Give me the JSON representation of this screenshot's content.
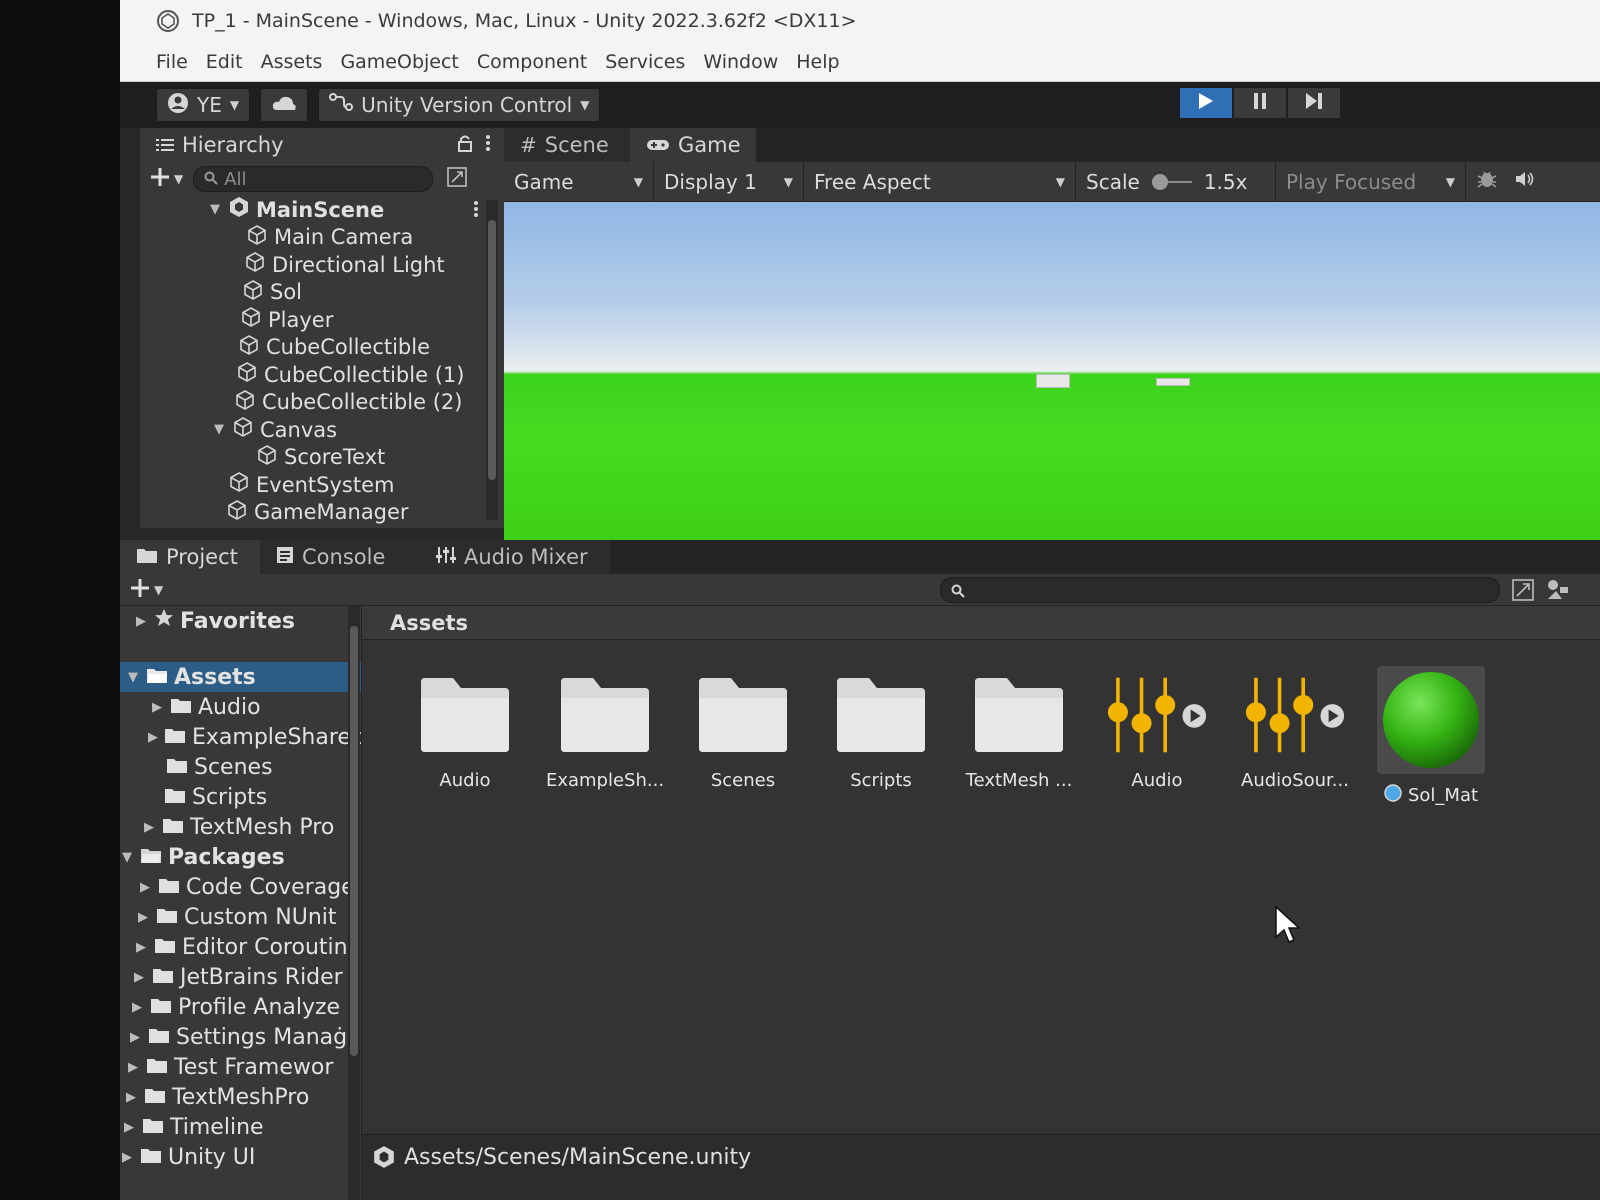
{
  "window": {
    "title": "TP_1 - MainScene - Windows, Mac, Linux - Unity 2022.3.62f2 <DX11>"
  },
  "menu": [
    "File",
    "Edit",
    "Assets",
    "GameObject",
    "Component",
    "Services",
    "Window",
    "Help"
  ],
  "toolbar": {
    "account": "YE",
    "version_control": "Unity Version Control"
  },
  "hierarchy": {
    "tab": "Hierarchy",
    "search_placeholder": "All",
    "scene": "MainScene",
    "items": [
      "Main Camera",
      "Directional Light",
      "Sol",
      "Player",
      "CubeCollectible",
      "CubeCollectible (1)",
      "CubeCollectible (2)",
      "Canvas",
      "ScoreText",
      "EventSystem",
      "GameManager"
    ]
  },
  "view_tabs": [
    "Scene",
    "Game"
  ],
  "game_options": {
    "mode": "Game",
    "display": "Display 1",
    "aspect": "Free Aspect",
    "scale_label": "Scale",
    "scale_value": "1.5x",
    "play_mode": "Play Focused"
  },
  "bottom_tabs": [
    "Project",
    "Console",
    "Audio Mixer"
  ],
  "project_tree": {
    "favorites": "Favorites",
    "assets_root": "Assets",
    "assets_children": [
      "Audio",
      "ExampleSharec",
      "Scenes",
      "Scripts",
      "TextMesh Pro"
    ],
    "packages_root": "Packages",
    "packages_children": [
      "Code Coveragе",
      "Custom NUnit",
      "Editor Coroutin",
      "JetBrains Rider",
      "Profile Analyze",
      "Settings Manaġ",
      "Test Framewor",
      "TextMeshPro",
      "Timeline",
      "Unity UI"
    ]
  },
  "assets_panel": {
    "breadcrumb": "Assets",
    "items": [
      {
        "label": "Audio",
        "kind": "folder"
      },
      {
        "label": "ExampleSh...",
        "kind": "folder"
      },
      {
        "label": "Scenes",
        "kind": "folder"
      },
      {
        "label": "Scripts",
        "kind": "folder"
      },
      {
        "label": "TextMesh ...",
        "kind": "folder"
      },
      {
        "label": "Audio",
        "kind": "audio-mixer"
      },
      {
        "label": "AudioSour...",
        "kind": "audio-mixer"
      },
      {
        "label": "Sol_Mat",
        "kind": "material"
      }
    ]
  },
  "status": {
    "path": "Assets/Scenes/MainScene.unity"
  },
  "colors": {
    "selection": "#2c5d87",
    "play_active": "#2f6fb5",
    "ground_green": "#3fd31a",
    "mixer_yellow": "#f2b400"
  }
}
